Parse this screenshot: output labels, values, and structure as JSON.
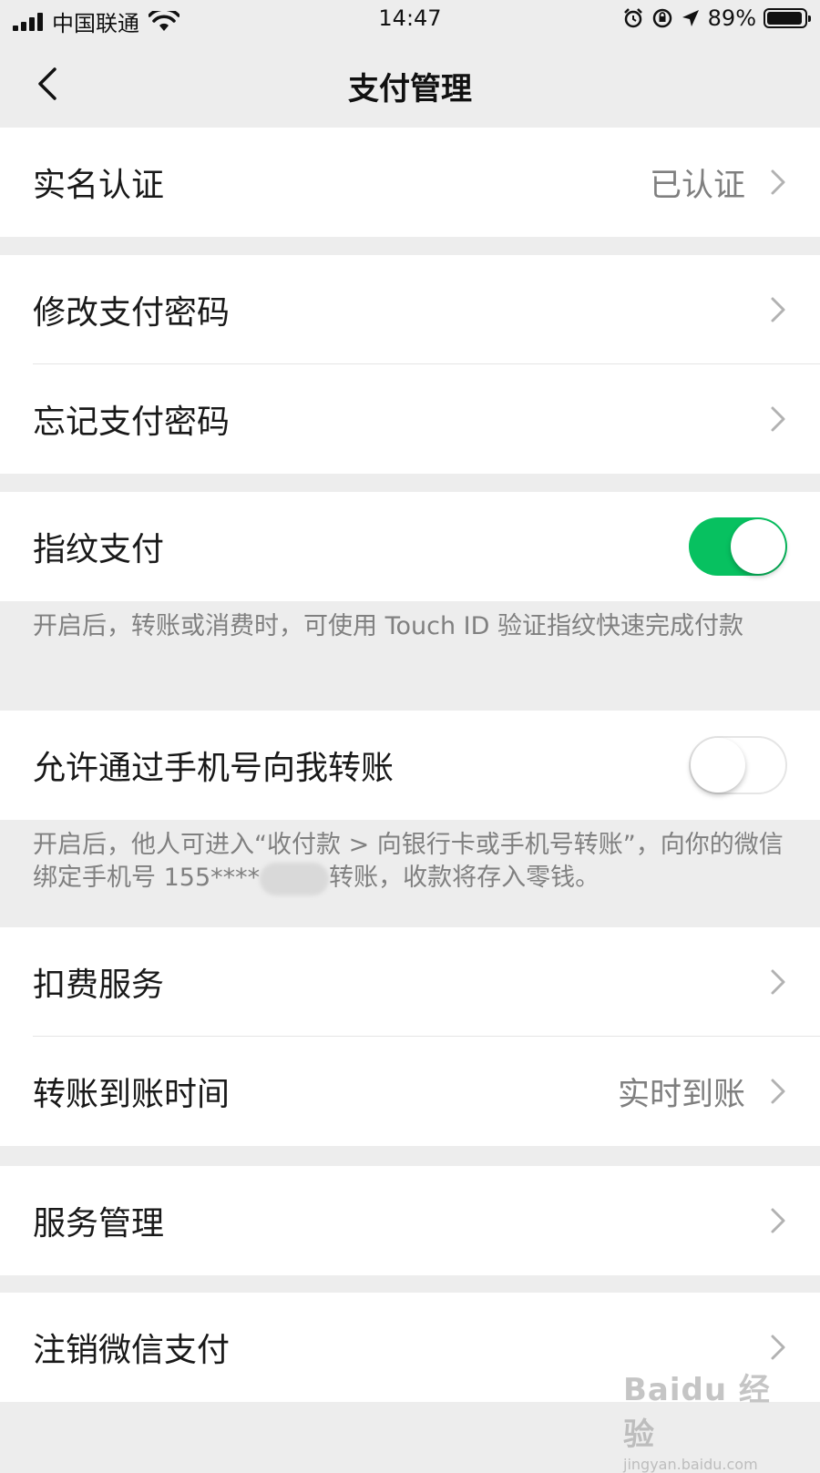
{
  "status_bar": {
    "carrier": "中国联通",
    "time": "14:47",
    "battery": "89%",
    "battery_level": 0.89
  },
  "nav": {
    "title": "支付管理"
  },
  "rows": {
    "real_name": {
      "label": "实名认证",
      "value": "已认证"
    },
    "change_password": {
      "label": "修改支付密码"
    },
    "forgot_password": {
      "label": "忘记支付密码"
    },
    "fingerprint": {
      "label": "指纹支付",
      "enabled": true
    },
    "fingerprint_note": "开启后，转账或消费时，可使用 Touch ID 验证指纹快速完成付款",
    "phone_transfer": {
      "label": "允许通过手机号向我转账",
      "enabled": false
    },
    "phone_transfer_note_part1": "开启后，他人可进入“收付款 > 向银行卡或手机号转账”，向你的微信绑定手机号 155****",
    "phone_transfer_note_part2": "转账，收款将存入零钱。",
    "deduction": {
      "label": "扣费服务"
    },
    "arrival_time": {
      "label": "转账到账时间",
      "value": "实时到账"
    },
    "service_manage": {
      "label": "服务管理"
    },
    "cancel_pay": {
      "label": "注销微信支付"
    }
  },
  "watermark": {
    "brand": "Baidu 经验",
    "url": "jingyan.baidu.com"
  },
  "colors": {
    "accent_green": "#07c160",
    "background": "#ededed"
  }
}
